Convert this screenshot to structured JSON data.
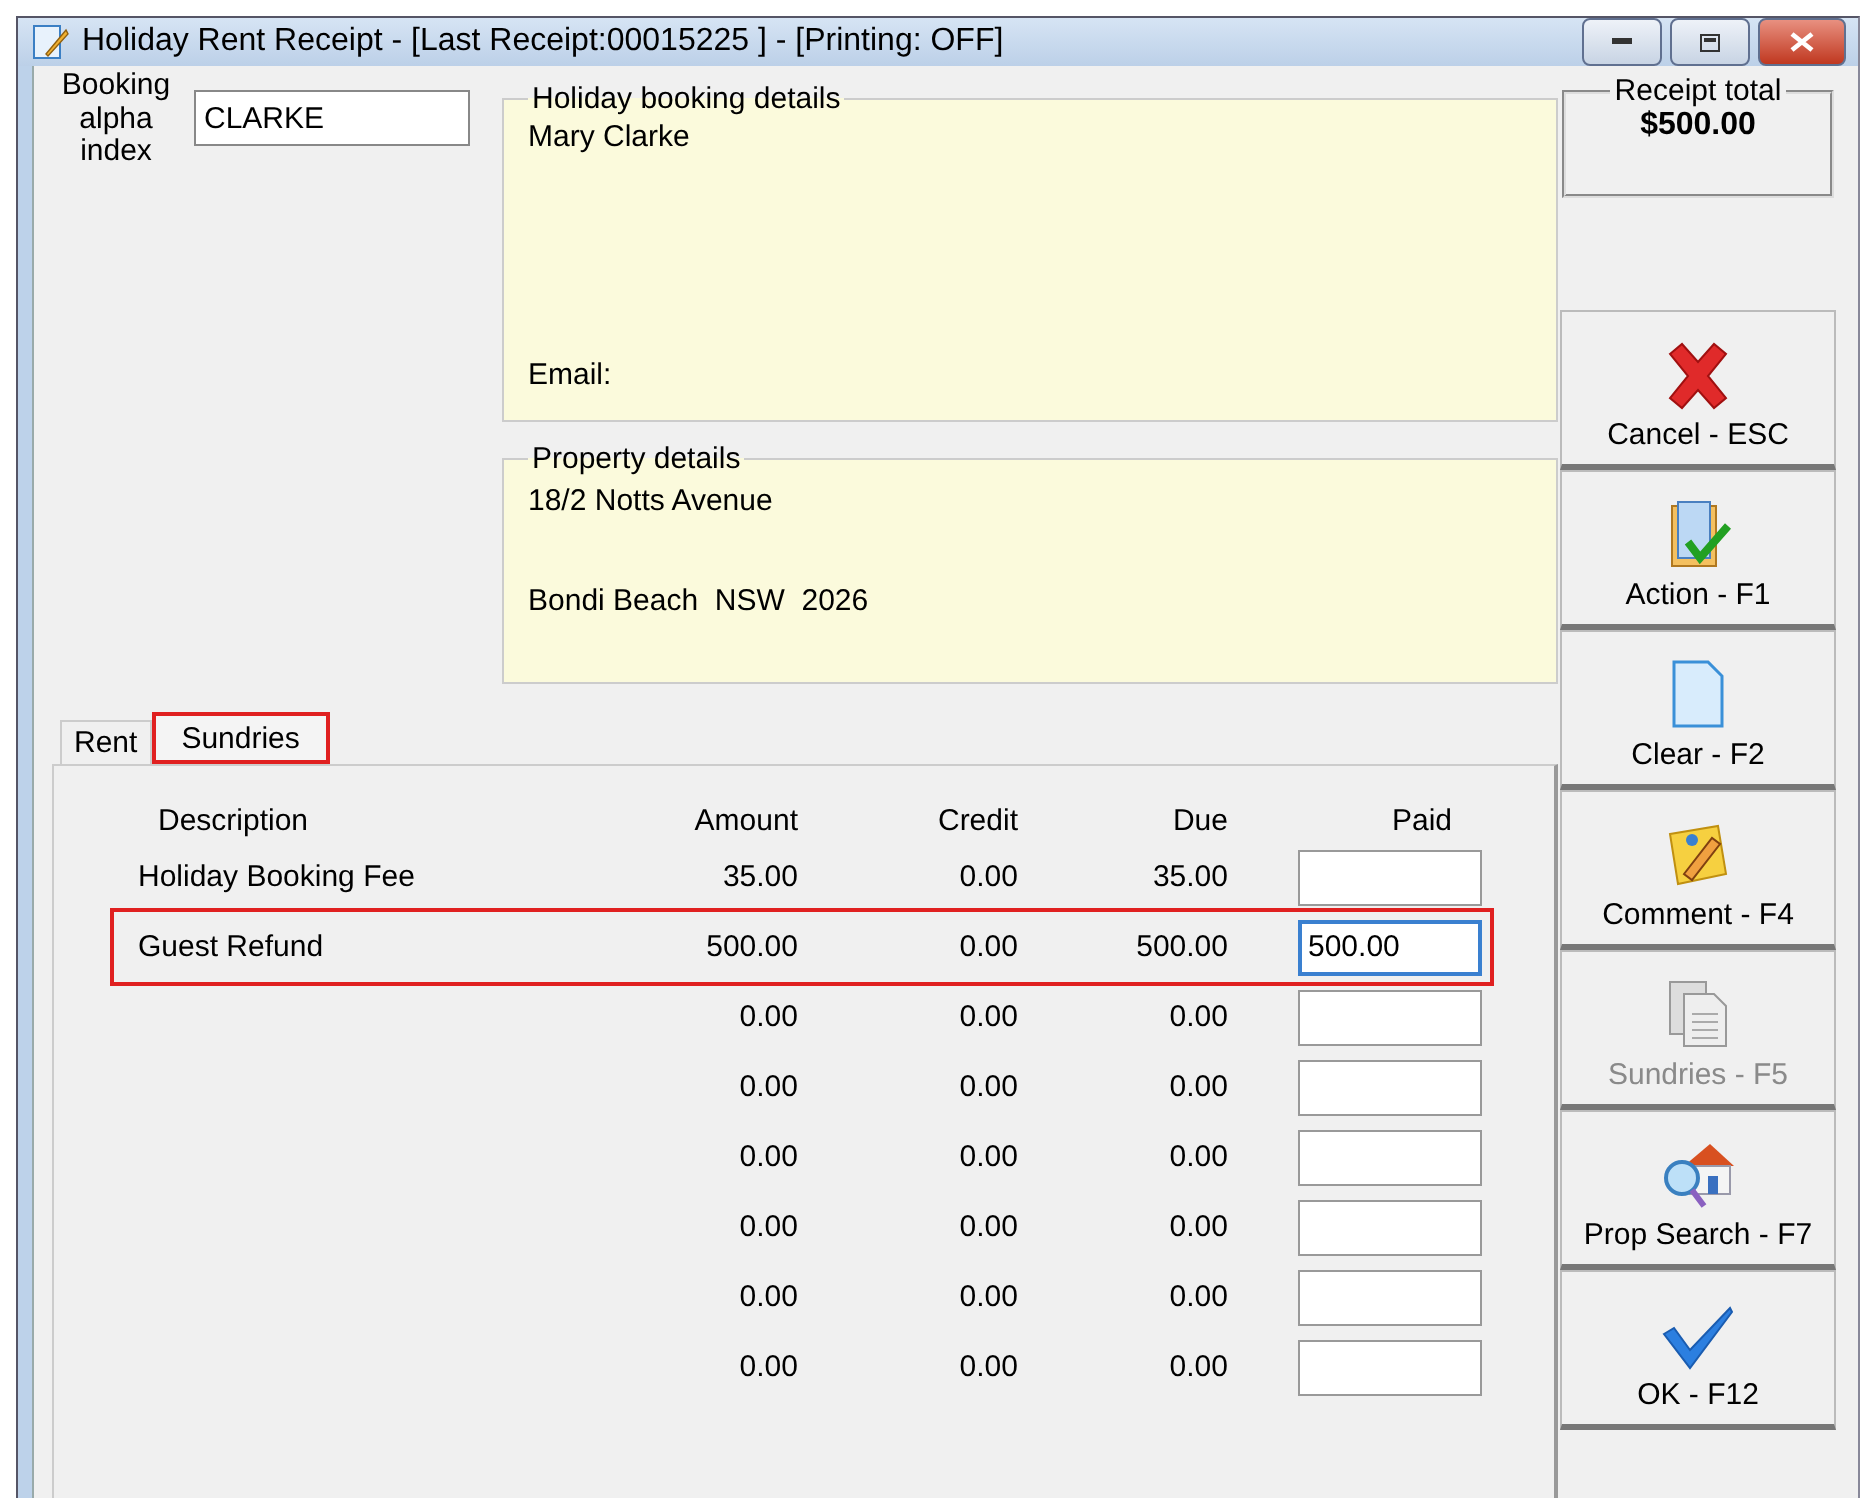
{
  "window": {
    "title": "Holiday Rent Receipt - [Last Receipt:00015225 ] - [Printing: OFF]"
  },
  "booking": {
    "label": "Booking alpha index",
    "value": "CLARKE"
  },
  "booking_details": {
    "title": "Holiday booking details",
    "name": "Mary Clarke",
    "email_label": "Email:"
  },
  "property_details": {
    "title": "Property details",
    "street": "18/2 Notts Avenue",
    "locality": "Bondi Beach  NSW  2026"
  },
  "receipt_total": {
    "title": "Receipt total",
    "value": "$500.00"
  },
  "tabs": [
    {
      "label": "Rent",
      "selected": false,
      "highlighted": false
    },
    {
      "label": "Sundries",
      "selected": true,
      "highlighted": true
    }
  ],
  "table": {
    "columns": [
      "Description",
      "Amount",
      "Credit",
      "Due",
      "Paid"
    ],
    "rows": [
      {
        "description": "Holiday Booking Fee",
        "amount": "35.00",
        "credit": "0.00",
        "due": "35.00",
        "paid": "",
        "focused": false,
        "highlighted": false
      },
      {
        "description": "Guest Refund",
        "amount": "500.00",
        "credit": "0.00",
        "due": "500.00",
        "paid": "500.00",
        "focused": true,
        "highlighted": true
      },
      {
        "amount": "0.00",
        "credit": "0.00",
        "due": "0.00",
        "paid": "",
        "focused": false,
        "highlighted": false
      },
      {
        "amount": "0.00",
        "credit": "0.00",
        "due": "0.00",
        "paid": "",
        "focused": false,
        "highlighted": false
      },
      {
        "amount": "0.00",
        "credit": "0.00",
        "due": "0.00",
        "paid": "",
        "focused": false,
        "highlighted": false
      },
      {
        "amount": "0.00",
        "credit": "0.00",
        "due": "0.00",
        "paid": "",
        "focused": false,
        "highlighted": false
      },
      {
        "amount": "0.00",
        "credit": "0.00",
        "due": "0.00",
        "paid": "",
        "focused": false,
        "highlighted": false
      },
      {
        "amount": "0.00",
        "credit": "0.00",
        "due": "0.00",
        "paid": "",
        "focused": false,
        "highlighted": false
      }
    ]
  },
  "buttons": [
    {
      "kind": "cancel",
      "label": "Cancel - ESC",
      "disabled": false
    },
    {
      "kind": "action",
      "label": "Action - F1",
      "disabled": false
    },
    {
      "kind": "clear",
      "label": "Clear - F2",
      "disabled": false
    },
    {
      "kind": "comment",
      "label": "Comment - F4",
      "disabled": false
    },
    {
      "kind": "sundries",
      "label": "Sundries - F5",
      "disabled": true
    },
    {
      "kind": "search",
      "label": "Prop Search - F7",
      "disabled": false
    },
    {
      "kind": "ok",
      "label": "OK - F12",
      "disabled": false
    }
  ]
}
